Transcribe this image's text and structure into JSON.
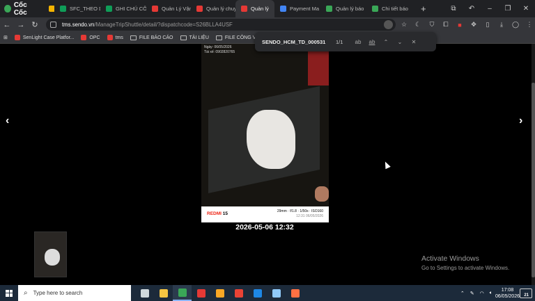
{
  "browser": {
    "brand": "Cốc Cốc",
    "tabs": [
      {
        "label": "",
        "icon": "drive-icon",
        "color": "#f4b400"
      },
      {
        "label": "SFC_THEO D",
        "icon": "sheets-icon",
        "color": "#0f9d58"
      },
      {
        "label": "GHI CHÚ CÔ",
        "icon": "sheets-icon",
        "color": "#0f9d58"
      },
      {
        "label": "Quản Lý Vận",
        "icon": "sendo-icon",
        "color": "#e53935"
      },
      {
        "label": "Quản lý chuy",
        "icon": "sendo-icon",
        "color": "#e53935"
      },
      {
        "label": "Quản lý",
        "icon": "sendo-icon",
        "color": "#e53935",
        "active": true
      },
      {
        "label": "Payment Ma",
        "icon": "payment-icon",
        "color": "#4285f4"
      },
      {
        "label": "Quản lý báo",
        "icon": "globe-icon",
        "color": "#3aa757"
      },
      {
        "label": "Chi tiết báo",
        "icon": "globe-icon",
        "color": "#3aa757"
      }
    ],
    "url_host": "tms.sendo.vn",
    "url_path": "/ManageTripShuttle/detail/?dispatchcode=S26BLLA4USF",
    "bookmarks": [
      {
        "label": "SenLight Case Platfor...",
        "type": "sendo"
      },
      {
        "label": "OPC",
        "type": "sendo"
      },
      {
        "label": "tms",
        "type": "sendo"
      },
      {
        "label": "FILE BÁO CÁO",
        "type": "folder"
      },
      {
        "label": "TÀI LIỆU",
        "type": "folder"
      },
      {
        "label": "FILE CÔNG VIỆC",
        "type": "folder"
      }
    ],
    "find": {
      "query": "SENDO_HCM_TD_000531",
      "count": "1/1",
      "match_case": "ab",
      "whole_word": "ab"
    }
  },
  "viewer": {
    "stamp_line1": "Ngày: 06/05/2026",
    "stamp_line2": "Tài xế: 0902820765",
    "camera_model_a": "REDMI",
    "camera_model_b": "15",
    "camera_spec_line1": "29mm · f/1.8 · 1/50s · ISO160",
    "camera_spec_line2": "12:31 06/05/2026",
    "datetime": "2026-05-06 12:32"
  },
  "watermark": {
    "title": "Activate Windows",
    "subtitle": "Go to Settings to activate Windows."
  },
  "taskbar": {
    "search_placeholder": "Type here to search",
    "apps": [
      {
        "name": "task-view",
        "color": "#cfd8dc"
      },
      {
        "name": "file-explorer",
        "color": "#f5c542"
      },
      {
        "name": "coccoc-browser",
        "color": "#3aa757",
        "active": true
      },
      {
        "name": "wps-office",
        "color": "#e53935"
      },
      {
        "name": "sticky-notes",
        "color": "#f9a825"
      },
      {
        "name": "chrome",
        "color": "#ea4335"
      },
      {
        "name": "zalo",
        "color": "#1e88e5"
      },
      {
        "name": "notepad",
        "color": "#90caf9"
      },
      {
        "name": "app-orange",
        "color": "#ff7043"
      }
    ],
    "time": "17:08",
    "date": "06/05/2026",
    "notifications": "21"
  }
}
